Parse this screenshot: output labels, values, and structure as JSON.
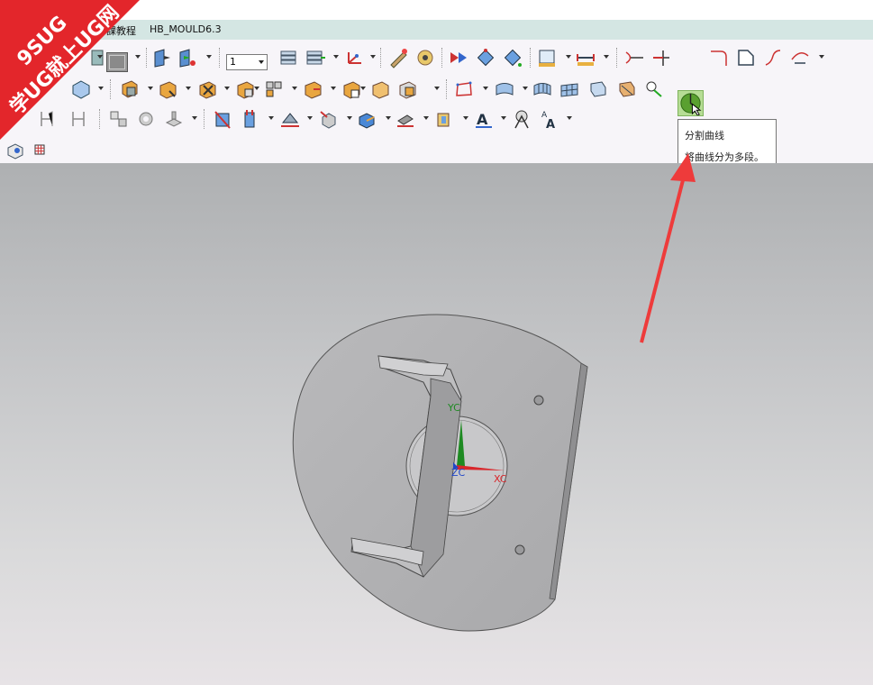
{
  "menubar": {
    "item1": "課教程",
    "item2": "HB_MOULD6.3"
  },
  "toolbar": {
    "layer_value": "1",
    "colors": {
      "active_bg": "#b6dd95",
      "accent_red": "#e03030",
      "accent_blue": "#3b6fc9"
    }
  },
  "tooltip": {
    "title": "分割曲线",
    "description": "将曲线分为多段。"
  },
  "viewport": {
    "axis_yc": "YC",
    "axis_zc": "ZC",
    "axis_xc": "XC"
  },
  "watermark": {
    "line1": "9SUG",
    "line2": "学UG就上UG网",
    "color": "#e3262b"
  }
}
